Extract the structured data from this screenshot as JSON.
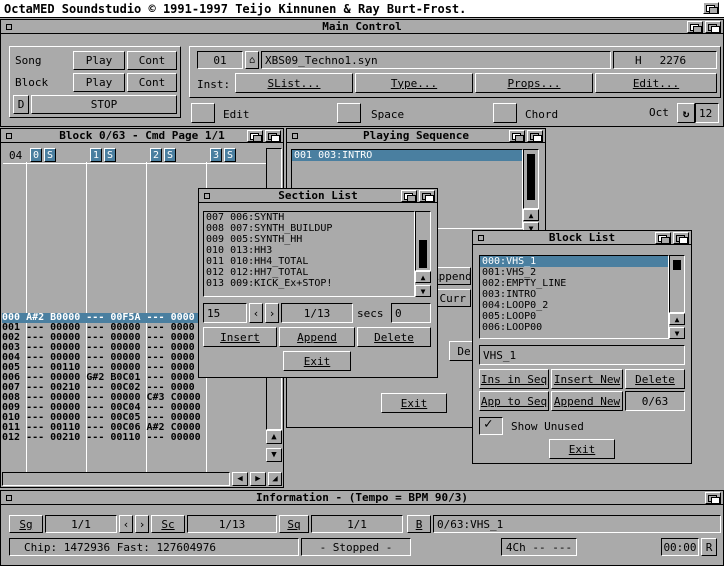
{
  "screen_title": "OctaMED Soundstudio  © 1991-1997 Teijo Kinnunen & Ray Burt-Frost.",
  "main_control": {
    "title": "Main Control",
    "song_label": "Song",
    "block_label": "Block",
    "play_label": "Play",
    "cont_label": "Cont",
    "d_label": "D",
    "stop_label": "STOP",
    "instrument_number": "01",
    "instrument_name": "XBS09_Techno1.syn",
    "hold_label": "H",
    "hold_value": "2276",
    "inst_label": "Inst:",
    "slist_label": "SList...",
    "type_label": "Type...",
    "props_label": "Props...",
    "edit_dots_label": "Edit...",
    "edit_toggle_label": "Edit",
    "space_toggle_label": "Space",
    "chord_toggle_label": "Chord",
    "oct_label": "Oct",
    "oct_value": "12"
  },
  "block_editor": {
    "title": "Block 0/63 - Cmd Page 1/1",
    "header_line_number": "04",
    "tracks": [
      {
        "a": "0",
        "b": "S"
      },
      {
        "a": "1",
        "b": "S"
      },
      {
        "a": "2",
        "b": "S"
      },
      {
        "a": "3",
        "b": "S"
      }
    ],
    "current_row": "000 A#2 B0000 --- 00F5A --- 0000",
    "rows": [
      "001 --- 00000 --- 00000 --- 0000",
      "002 --- 00000 --- 00000 --- 0000",
      "003 --- 00000 --- 00000 --- 0000",
      "004 --- 00000 --- 00000 --- 0000",
      "005 --- 00110 --- 00000 --- 0000",
      "006 --- 00000 G#2 B0C01 --- 0000",
      "007 --- 00210 --- 00C02 --- 0000",
      "008 --- 00000 --- 00000 C#3 C0000",
      "009 --- 00000 --- 00C04 --- 00000",
      "010 --- 00000 --- 00C05 --- 00000",
      "011 --- 00110 --- 00C06 A#2 C0000",
      "012 --- 00210 --- 00110 --- 00000"
    ]
  },
  "playing_sequence": {
    "title": "Playing Sequence",
    "items": [
      "001 003:INTRO"
    ],
    "partial_append": "Append",
    "partial_curr": "Curr",
    "partial_d": "De",
    "exit_label": "Exit"
  },
  "section_list": {
    "title": "Section List",
    "items": [
      "007 006:SYNTH",
      "008 007:SYNTH_BUILDUP",
      "009 005:SYNTH_HH",
      "010 013:HH3",
      "011 010:HH4_TOTAL",
      "012 012:HH7_TOTAL",
      "013 009:KICK_Ex+STOP!"
    ],
    "field_value": "15",
    "position": "1/13",
    "secs_label": "secs",
    "secs_value": "0",
    "insert_label": "Insert",
    "append_label": "Append",
    "delete_label": "Delete",
    "exit_label": "Exit"
  },
  "block_list": {
    "title": "Block List",
    "items": [
      "000:VHS_1",
      "001:VHS_2",
      "002:EMPTY_LINE",
      "003:INTRO",
      "004:LOOP0_2",
      "005:LOOP0",
      "006:LOOP00"
    ],
    "selected_index": 0,
    "name_field": "VHS_1",
    "ins_in_seq_label": "Ins in Seq",
    "insert_new_label": "Insert New",
    "delete_label": "Delete",
    "app_to_seq_label": "App to Seq",
    "append_new_label": "Append New",
    "count": "0/63",
    "show_unused_label": "Show Unused",
    "exit_label": "Exit"
  },
  "information": {
    "title": "Information - (Tempo = BPM 90/3)",
    "sg_label": "Sg",
    "sg_value": "1/1",
    "sc_label": "Sc",
    "sc_value": "1/13",
    "sq_label": "Sq",
    "sq_value": "1/1",
    "b_label": "B",
    "block_value": "0/63:VHS_1",
    "memory": "Chip: 1472936 Fast: 127604976",
    "status": "- Stopped -",
    "channels": "4Ch -- ---",
    "time": "00:00",
    "r_label": "R"
  }
}
